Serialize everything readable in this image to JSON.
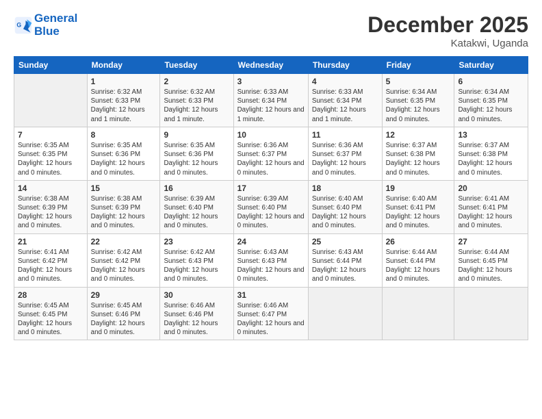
{
  "header": {
    "logo_line1": "General",
    "logo_line2": "Blue",
    "month": "December 2025",
    "location": "Katakwi, Uganda"
  },
  "weekdays": [
    "Sunday",
    "Monday",
    "Tuesday",
    "Wednesday",
    "Thursday",
    "Friday",
    "Saturday"
  ],
  "weeks": [
    [
      {
        "day": "",
        "sunrise": "",
        "sunset": "",
        "daylight": "",
        "empty": true
      },
      {
        "day": "1",
        "sunrise": "Sunrise: 6:32 AM",
        "sunset": "Sunset: 6:33 PM",
        "daylight": "Daylight: 12 hours and 1 minute."
      },
      {
        "day": "2",
        "sunrise": "Sunrise: 6:32 AM",
        "sunset": "Sunset: 6:33 PM",
        "daylight": "Daylight: 12 hours and 1 minute."
      },
      {
        "day": "3",
        "sunrise": "Sunrise: 6:33 AM",
        "sunset": "Sunset: 6:34 PM",
        "daylight": "Daylight: 12 hours and 1 minute."
      },
      {
        "day": "4",
        "sunrise": "Sunrise: 6:33 AM",
        "sunset": "Sunset: 6:34 PM",
        "daylight": "Daylight: 12 hours and 1 minute."
      },
      {
        "day": "5",
        "sunrise": "Sunrise: 6:34 AM",
        "sunset": "Sunset: 6:35 PM",
        "daylight": "Daylight: 12 hours and 0 minutes."
      },
      {
        "day": "6",
        "sunrise": "Sunrise: 6:34 AM",
        "sunset": "Sunset: 6:35 PM",
        "daylight": "Daylight: 12 hours and 0 minutes."
      }
    ],
    [
      {
        "day": "7",
        "sunrise": "Sunrise: 6:35 AM",
        "sunset": "Sunset: 6:35 PM",
        "daylight": "Daylight: 12 hours and 0 minutes."
      },
      {
        "day": "8",
        "sunrise": "Sunrise: 6:35 AM",
        "sunset": "Sunset: 6:36 PM",
        "daylight": "Daylight: 12 hours and 0 minutes."
      },
      {
        "day": "9",
        "sunrise": "Sunrise: 6:35 AM",
        "sunset": "Sunset: 6:36 PM",
        "daylight": "Daylight: 12 hours and 0 minutes."
      },
      {
        "day": "10",
        "sunrise": "Sunrise: 6:36 AM",
        "sunset": "Sunset: 6:37 PM",
        "daylight": "Daylight: 12 hours and 0 minutes."
      },
      {
        "day": "11",
        "sunrise": "Sunrise: 6:36 AM",
        "sunset": "Sunset: 6:37 PM",
        "daylight": "Daylight: 12 hours and 0 minutes."
      },
      {
        "day": "12",
        "sunrise": "Sunrise: 6:37 AM",
        "sunset": "Sunset: 6:38 PM",
        "daylight": "Daylight: 12 hours and 0 minutes."
      },
      {
        "day": "13",
        "sunrise": "Sunrise: 6:37 AM",
        "sunset": "Sunset: 6:38 PM",
        "daylight": "Daylight: 12 hours and 0 minutes."
      }
    ],
    [
      {
        "day": "14",
        "sunrise": "Sunrise: 6:38 AM",
        "sunset": "Sunset: 6:39 PM",
        "daylight": "Daylight: 12 hours and 0 minutes."
      },
      {
        "day": "15",
        "sunrise": "Sunrise: 6:38 AM",
        "sunset": "Sunset: 6:39 PM",
        "daylight": "Daylight: 12 hours and 0 minutes."
      },
      {
        "day": "16",
        "sunrise": "Sunrise: 6:39 AM",
        "sunset": "Sunset: 6:40 PM",
        "daylight": "Daylight: 12 hours and 0 minutes."
      },
      {
        "day": "17",
        "sunrise": "Sunrise: 6:39 AM",
        "sunset": "Sunset: 6:40 PM",
        "daylight": "Daylight: 12 hours and 0 minutes."
      },
      {
        "day": "18",
        "sunrise": "Sunrise: 6:40 AM",
        "sunset": "Sunset: 6:40 PM",
        "daylight": "Daylight: 12 hours and 0 minutes."
      },
      {
        "day": "19",
        "sunrise": "Sunrise: 6:40 AM",
        "sunset": "Sunset: 6:41 PM",
        "daylight": "Daylight: 12 hours and 0 minutes."
      },
      {
        "day": "20",
        "sunrise": "Sunrise: 6:41 AM",
        "sunset": "Sunset: 6:41 PM",
        "daylight": "Daylight: 12 hours and 0 minutes."
      }
    ],
    [
      {
        "day": "21",
        "sunrise": "Sunrise: 6:41 AM",
        "sunset": "Sunset: 6:42 PM",
        "daylight": "Daylight: 12 hours and 0 minutes."
      },
      {
        "day": "22",
        "sunrise": "Sunrise: 6:42 AM",
        "sunset": "Sunset: 6:42 PM",
        "daylight": "Daylight: 12 hours and 0 minutes."
      },
      {
        "day": "23",
        "sunrise": "Sunrise: 6:42 AM",
        "sunset": "Sunset: 6:43 PM",
        "daylight": "Daylight: 12 hours and 0 minutes."
      },
      {
        "day": "24",
        "sunrise": "Sunrise: 6:43 AM",
        "sunset": "Sunset: 6:43 PM",
        "daylight": "Daylight: 12 hours and 0 minutes."
      },
      {
        "day": "25",
        "sunrise": "Sunrise: 6:43 AM",
        "sunset": "Sunset: 6:44 PM",
        "daylight": "Daylight: 12 hours and 0 minutes."
      },
      {
        "day": "26",
        "sunrise": "Sunrise: 6:44 AM",
        "sunset": "Sunset: 6:44 PM",
        "daylight": "Daylight: 12 hours and 0 minutes."
      },
      {
        "day": "27",
        "sunrise": "Sunrise: 6:44 AM",
        "sunset": "Sunset: 6:45 PM",
        "daylight": "Daylight: 12 hours and 0 minutes."
      }
    ],
    [
      {
        "day": "28",
        "sunrise": "Sunrise: 6:45 AM",
        "sunset": "Sunset: 6:45 PM",
        "daylight": "Daylight: 12 hours and 0 minutes."
      },
      {
        "day": "29",
        "sunrise": "Sunrise: 6:45 AM",
        "sunset": "Sunset: 6:46 PM",
        "daylight": "Daylight: 12 hours and 0 minutes."
      },
      {
        "day": "30",
        "sunrise": "Sunrise: 6:46 AM",
        "sunset": "Sunset: 6:46 PM",
        "daylight": "Daylight: 12 hours and 0 minutes."
      },
      {
        "day": "31",
        "sunrise": "Sunrise: 6:46 AM",
        "sunset": "Sunset: 6:47 PM",
        "daylight": "Daylight: 12 hours and 0 minutes."
      },
      {
        "day": "",
        "sunrise": "",
        "sunset": "",
        "daylight": "",
        "empty": true
      },
      {
        "day": "",
        "sunrise": "",
        "sunset": "",
        "daylight": "",
        "empty": true
      },
      {
        "day": "",
        "sunrise": "",
        "sunset": "",
        "daylight": "",
        "empty": true
      }
    ]
  ]
}
